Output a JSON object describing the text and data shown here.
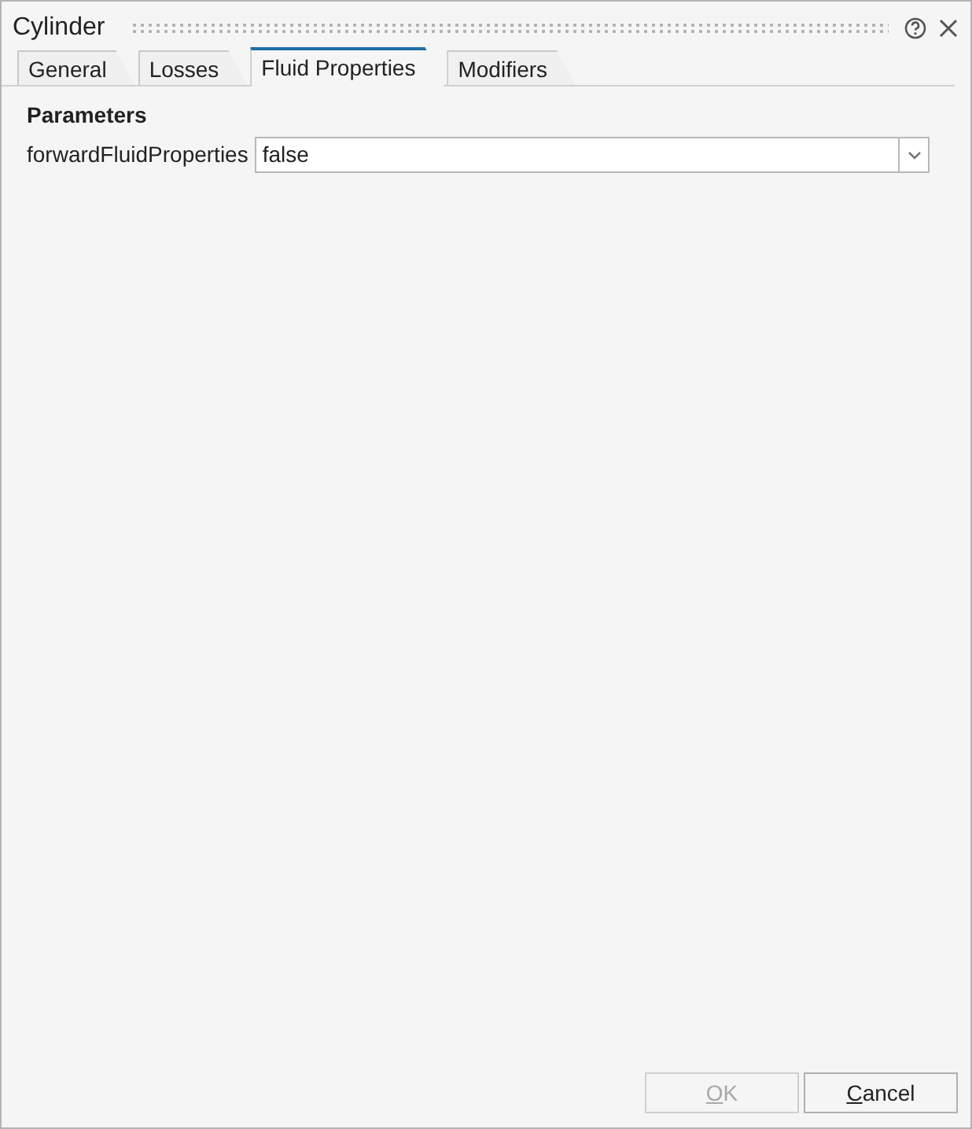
{
  "window": {
    "title": "Cylinder"
  },
  "tabs": [
    {
      "label": "General",
      "selected": false
    },
    {
      "label": "Losses",
      "selected": false
    },
    {
      "label": "Fluid Properties",
      "selected": true
    },
    {
      "label": "Modifiers",
      "selected": false
    }
  ],
  "section": {
    "title": "Parameters"
  },
  "parameters": [
    {
      "label": "forwardFluidProperties",
      "value": "false"
    }
  ],
  "buttons": [
    {
      "label": "OK",
      "disabled": true
    },
    {
      "label": "Cancel",
      "disabled": false
    }
  ]
}
